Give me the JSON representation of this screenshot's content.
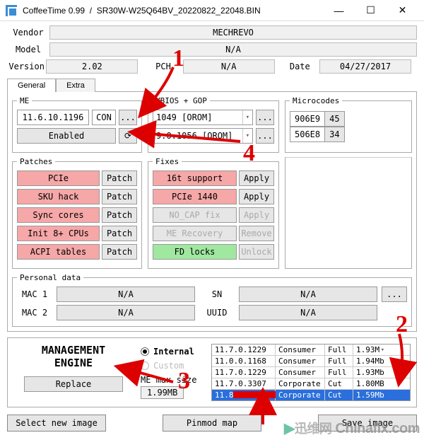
{
  "window": {
    "app": "CoffeeTime 0.99",
    "sep": "/",
    "file": "SR30W-W25Q64BV_20220822_22048.BIN",
    "minimize": "—",
    "maximize": "☐",
    "close": "✕"
  },
  "info": {
    "vendor_label": "Vendor",
    "vendor": "MECHREVO",
    "model_label": "Model",
    "model": "N/A",
    "version_label": "Version",
    "version": "2.02",
    "pch_label": "PCH",
    "pch": "N/A",
    "date_label": "Date",
    "date": "04/27/2017"
  },
  "tabs": {
    "general": "General",
    "extra": "Extra"
  },
  "me": {
    "legend": "ME",
    "value": "11.6.10.1196",
    "type": "CON",
    "browse": "...",
    "status": "Enabled",
    "refresh": "⟳"
  },
  "vbios": {
    "legend": "VBIOS + GOP",
    "opt1": "1049 [OROM]",
    "opt2": "9.0.1056 [OROM]",
    "browse": "..."
  },
  "micro": {
    "legend": "Microcodes",
    "chips": [
      {
        "name": "906E9",
        "count": "45"
      },
      {
        "name": "506E8",
        "count": "34"
      }
    ]
  },
  "patches": {
    "legend": "Patches",
    "items": [
      {
        "name": "PCIe",
        "act": "Patch"
      },
      {
        "name": "SKU hack",
        "act": "Patch"
      },
      {
        "name": "Sync cores",
        "act": "Patch"
      },
      {
        "name": "Init 8+ CPUs",
        "act": "Patch"
      },
      {
        "name": "ACPI tables",
        "act": "Patch"
      }
    ]
  },
  "fixes": {
    "legend": "Fixes",
    "items": [
      {
        "name": "16t support",
        "act": "Apply",
        "cls": "pink",
        "actcls": ""
      },
      {
        "name": "PCIe 1440",
        "act": "Apply",
        "cls": "pink",
        "actcls": ""
      },
      {
        "name": "NO_CAP fix",
        "act": "Apply",
        "cls": "dis",
        "actcls": "dis"
      },
      {
        "name": "ME Recovery",
        "act": "Remove",
        "cls": "dis",
        "actcls": "dis"
      },
      {
        "name": "FD locks",
        "act": "Unlock",
        "cls": "green",
        "actcls": "dis"
      }
    ]
  },
  "personal": {
    "legend": "Personal data",
    "mac1_label": "MAC 1",
    "mac1": "N/A",
    "sn_label": "SN",
    "sn": "N/A",
    "mac2_label": "MAC 2",
    "mac2": "N/A",
    "uuid_label": "UUID",
    "uuid": "N/A",
    "browse": "..."
  },
  "mgmt": {
    "title1": "MANAGEMENT",
    "title2": "ENGINE",
    "replace": "Replace",
    "internal": "Internal",
    "custom": "Custom",
    "maxsize_label": "ME max size",
    "maxsize": "1.99MB",
    "rows": [
      {
        "v": "11.7.0.1229",
        "t": "Consumer",
        "f": "Full",
        "s": "1.93M",
        "sel": false,
        "hdr": true
      },
      {
        "v": "11.0.0.1168",
        "t": "Consumer",
        "f": "Full",
        "s": "1.94Mb",
        "sel": false
      },
      {
        "v": "11.7.0.1229",
        "t": "Consumer",
        "f": "Full",
        "s": "1.93Mb",
        "sel": false
      },
      {
        "v": "11.7.0.3307",
        "t": "Corporate",
        "f": "Cut",
        "s": "1.80MB",
        "sel": false
      },
      {
        "v": "11.8.77.3664",
        "t": "Corporate",
        "f": "Cut",
        "s": "1.59Mb",
        "sel": true
      }
    ]
  },
  "bottom": {
    "select": "Select new image",
    "pinmod": "Pinmod map",
    "save": "Save image"
  },
  "watermark": {
    "cn": "迅维网",
    "en": "Chinafix.com"
  },
  "anno": {
    "n1": "1",
    "n2": "2",
    "n3": "3",
    "n4": "4"
  }
}
